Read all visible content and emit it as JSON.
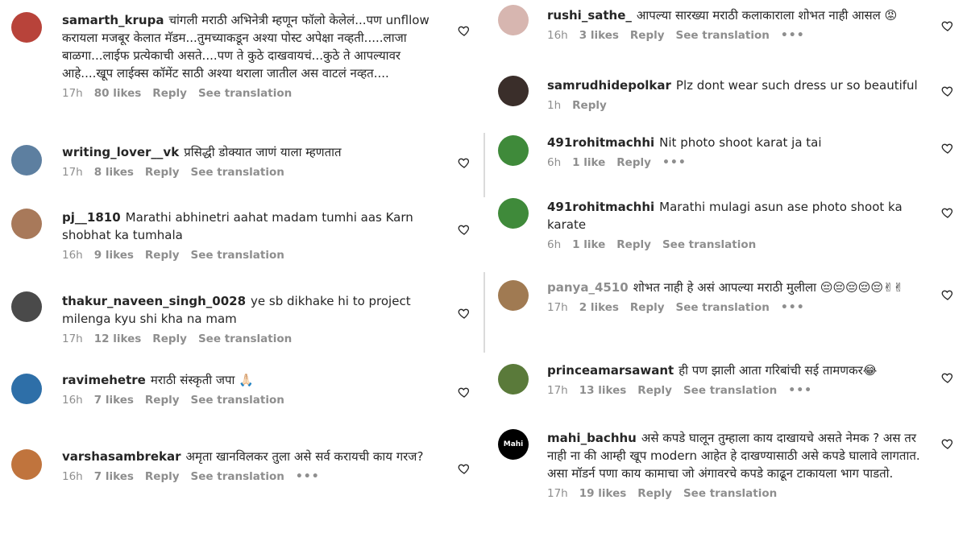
{
  "left": [
    {
      "user": "samarth_krupa",
      "text": "चांगली मराठी अभिनेत्री म्हणून फॉलो केलेलं...पण unfllow करायला मजबूर केलात मॅडम...तुमच्याकडून अश्या पोस्ट अपेक्षा नव्हती.....लाजा बाळगा...लाईफ प्रत्येकाची असते....पण ते कुठे दाखवायचं...कुठे ते आपल्यावर आहे....खूप लाईक्स कॉमेंट साठी अश्या थराला जातील अस वाटलं नव्हत....",
      "time": "17h",
      "likes": "80 likes",
      "reply": "Reply",
      "translate": "See translation",
      "more": ""
    },
    {
      "user": "writing_lover__vk",
      "text": "प्रसिद्धी डोक्यात जाणं याला म्हणतात",
      "time": "17h",
      "likes": "8 likes",
      "reply": "Reply",
      "translate": "See translation",
      "more": ""
    },
    {
      "user": "pj__1810",
      "text": "Marathi abhinetri aahat madam tumhi aas Karn shobhat ka tumhala",
      "time": "16h",
      "likes": "9 likes",
      "reply": "Reply",
      "translate": "See translation",
      "more": ""
    },
    {
      "user": "thakur_naveen_singh_0028",
      "text": "ye sb dikhake hi to project milenga kyu shi kha na mam",
      "time": "17h",
      "likes": "12 likes",
      "reply": "Reply",
      "translate": "See translation",
      "more": ""
    },
    {
      "user": "ravimehetre",
      "text": "मराठी संस्कृती जपा 🙏🏻",
      "time": "16h",
      "likes": "7 likes",
      "reply": "Reply",
      "translate": "See translation",
      "more": ""
    },
    {
      "user": "varshasambrekar",
      "text": "अमृता खानविलकर तुला असे सर्व करायची काय गरज?",
      "time": "16h",
      "likes": "7 likes",
      "reply": "Reply",
      "translate": "See translation",
      "more": "•••"
    }
  ],
  "right": [
    {
      "user": "rushi_sathe_",
      "text": "आपल्या सारख्या मराठी कलाकाराला शोभत नाही आसल 😡",
      "time": "16h",
      "likes": "3 likes",
      "reply": "Reply",
      "translate": "See translation",
      "more": "•••"
    },
    {
      "user": "samrudhidepolkar",
      "text": "Plz dont wear such dress ur so beautiful",
      "time": "1h",
      "likes": "",
      "reply": "Reply",
      "translate": "",
      "more": ""
    },
    {
      "user": "491rohitmachhi",
      "text": "Nit photo shoot karat ja tai",
      "time": "6h",
      "likes": "1 like",
      "reply": "Reply",
      "translate": "",
      "more": "•••"
    },
    {
      "user": "491rohitmachhi",
      "text": "Marathi mulagi asun ase photo shoot ka karate",
      "time": "6h",
      "likes": "1 like",
      "reply": "Reply",
      "translate": "See translation",
      "more": ""
    },
    {
      "user": "panya_4510",
      "text": "शोभत नाही हे असं आपल्या मराठी मुलीला 😔😔😔😔😔✌✌",
      "time": "17h",
      "likes": "2 likes",
      "reply": "Reply",
      "translate": "See translation",
      "more": "•••"
    },
    {
      "user": "princeamarsawant",
      "text": "ही पण झाली आता गरिबांची सई तामणकर😂",
      "time": "17h",
      "likes": "13 likes",
      "reply": "Reply",
      "translate": "See translation",
      "more": "•••"
    },
    {
      "user": "mahi_bachhu",
      "text": "असे कपडे घालून तुम्हाला काय दाखायचे असते नेमक ? अस तर नाही ना की आम्ही खूप modern आहेत हे दाखण्यासाठी असे कपडे घालावे लागतात. असा मॉडर्न पणा काय कामाचा जो अंगावरचे कपडे काढून टाकायला भाग पाडतो.",
      "time": "17h",
      "likes": "19 likes",
      "reply": "Reply",
      "translate": "See translation",
      "more": ""
    }
  ],
  "avatars": {
    "left": [
      "#b8433a",
      "#5d7fa0",
      "#a8795a",
      "#4a4a4a",
      "#2e6fa8",
      "#c0743d"
    ],
    "right": [
      "#d7b6b0",
      "#3a2e2a",
      "#3f8a3a",
      "#3f8a3a",
      "#a07a52",
      "#5a7a3a",
      "#000000"
    ]
  },
  "avatar_labels": {
    "mahi": "Mahi"
  }
}
